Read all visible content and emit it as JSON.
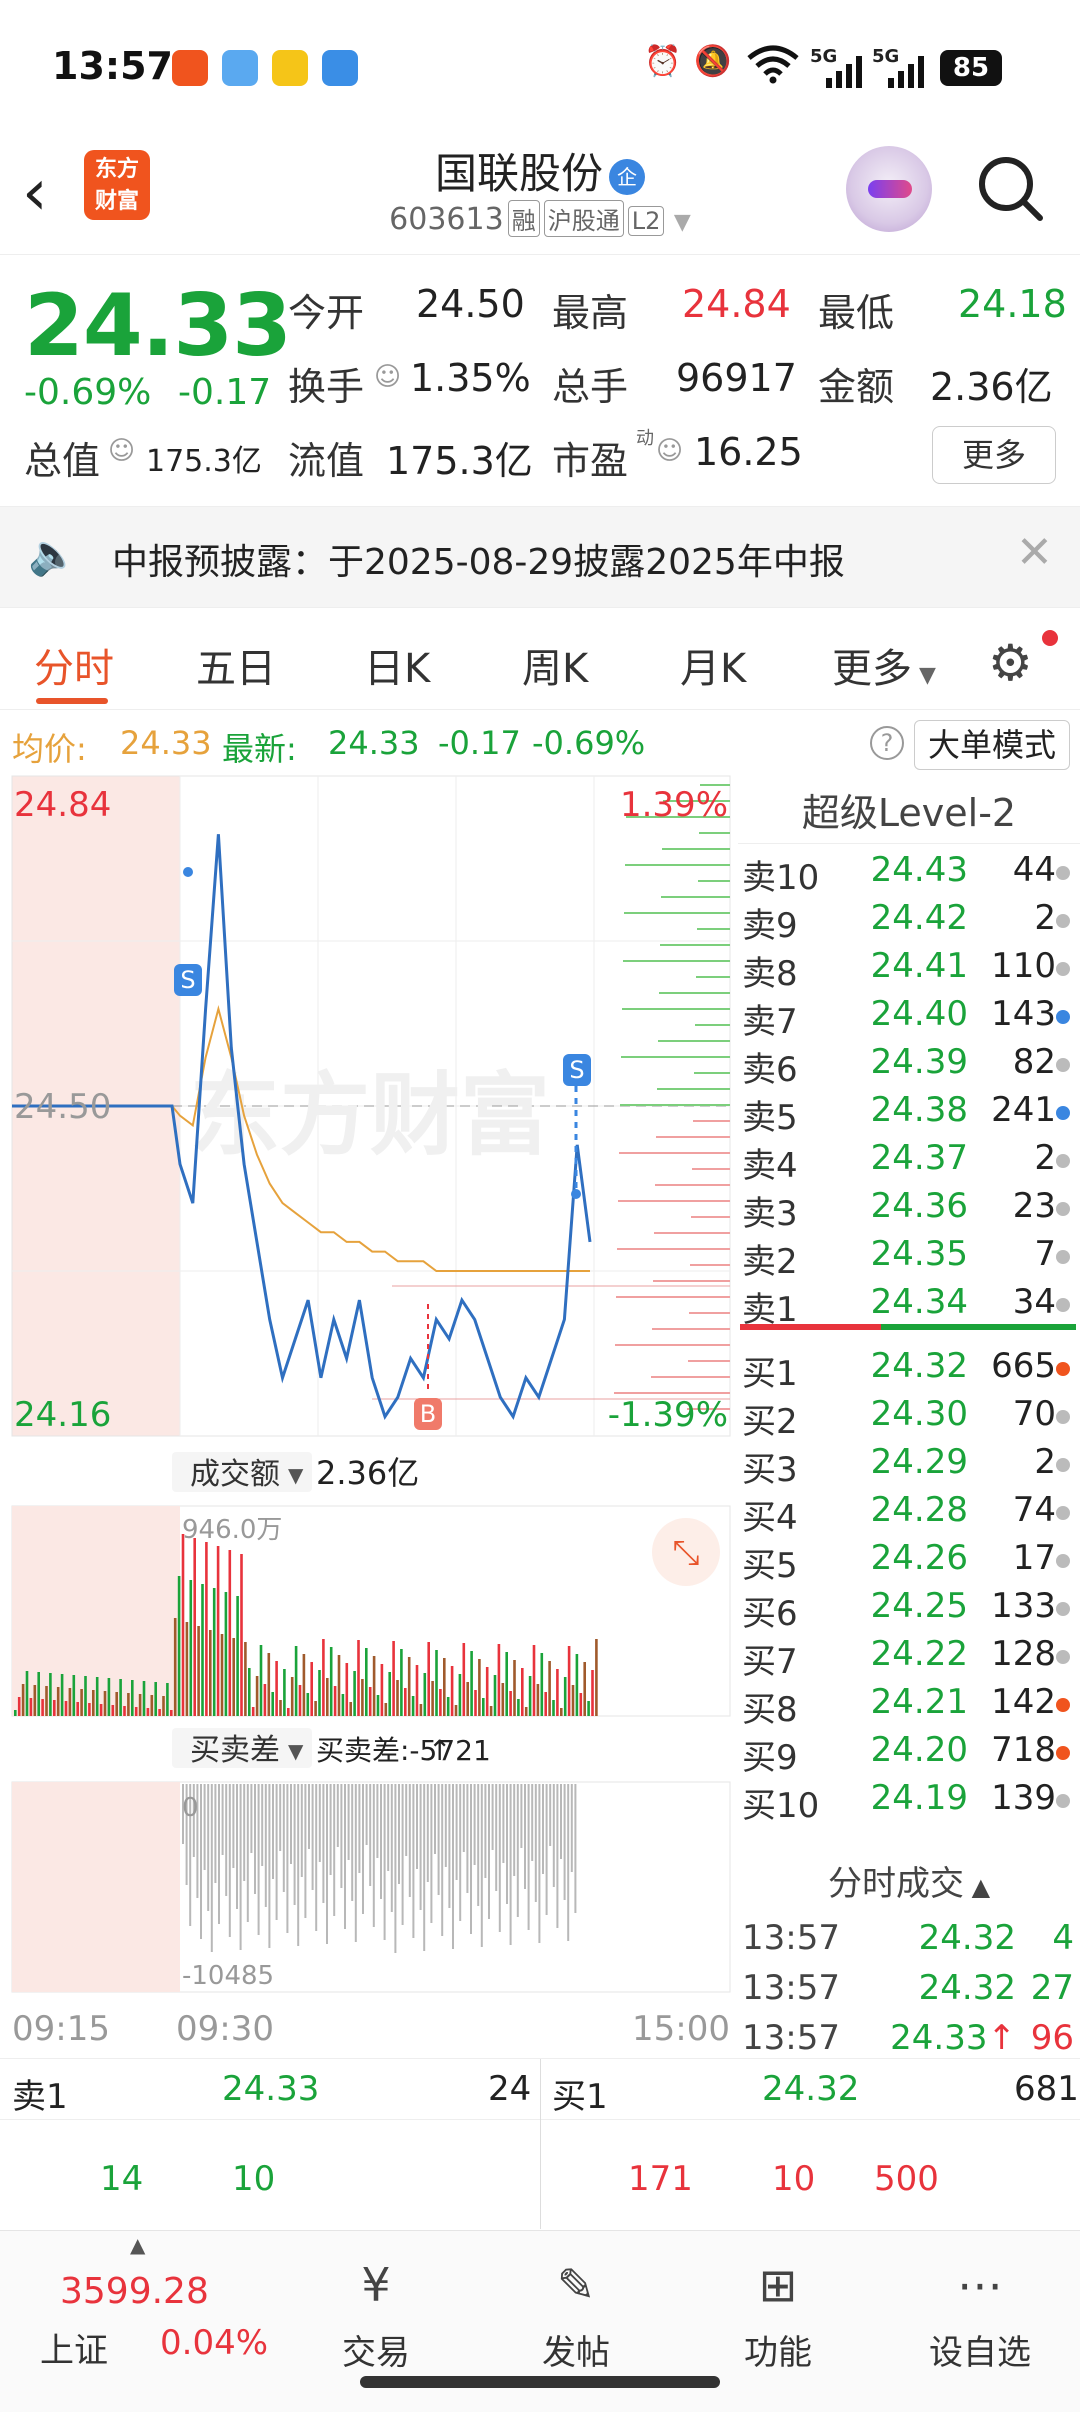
{
  "status_bar": {
    "time": "13:57",
    "network_1": "5G",
    "network_2": "5G",
    "battery": "85"
  },
  "header": {
    "logo_line1": "东方",
    "logo_line2": "财富",
    "stock_name": "国联股份",
    "stock_name_badge": "企",
    "stock_code": "603613",
    "tags": [
      "融",
      "沪股通",
      "L2"
    ]
  },
  "quote": {
    "price": "24.33",
    "change_pct": "-0.69%",
    "change": "-0.17",
    "open_label": "今开",
    "open": "24.50",
    "high_label": "最高",
    "high": "24.84",
    "low_label": "最低",
    "low": "24.18",
    "turnover_label": "换手",
    "turnover": "1.35%",
    "volume_label": "总手",
    "volume": "96917",
    "amount_label": "金额",
    "amount": "2.36亿",
    "mktcap_label": "总值",
    "mktcap": "175.3亿",
    "float_label": "流值",
    "float": "175.3亿",
    "pe_label": "市盈",
    "pe_sup": "动",
    "pe": "16.25",
    "more_label": "更多"
  },
  "notice": {
    "text": "中报预披露：于2025-08-29披露2025年中报"
  },
  "tabs": [
    "分时",
    "五日",
    "日K",
    "周K",
    "月K",
    "更多"
  ],
  "info_bar": {
    "avg_label": "均价:",
    "avg_value": "24.33",
    "latest_label": "最新:",
    "latest_value": "24.33",
    "latest_change": "-0.17",
    "latest_pct": "-0.69%",
    "help": "?",
    "big_order_mode": "大单模式"
  },
  "chart": {
    "top_price": "24.84",
    "mid_price": "24.50",
    "bottom_price": "24.16",
    "top_pct": "1.39%",
    "bottom_pct": "-1.39%",
    "marker_s": "S",
    "marker_b": "B",
    "watermark": "东方财富",
    "volume_selector": "成交额",
    "volume_total": "2.36亿",
    "volume_max": "946.0万",
    "diff_selector": "买卖差",
    "diff_label": "买卖差:-5721",
    "diff_zero": "0",
    "diff_min": "-10485",
    "time_start": "09:15",
    "time_open": "09:30",
    "time_end": "15:00",
    "colors": {
      "price_line": "#2f6fc0",
      "avg_line": "#e6a23c",
      "up": "#e8333c",
      "down": "#1aa33a"
    }
  },
  "chart_data": {
    "type": "line",
    "title": "",
    "xlabel": "",
    "ylabel": "",
    "ylim": [
      24.16,
      24.84
    ],
    "x_ticks": [
      "09:15",
      "09:30",
      "15:00"
    ],
    "series": [
      {
        "values": [
          24.5,
          24.5,
          24.5,
          24.44,
          24.4,
          24.6,
          24.78,
          24.56,
          24.44,
          24.36,
          24.28,
          24.22,
          24.26,
          24.3,
          24.22,
          24.28,
          24.24,
          24.3,
          24.22,
          24.18,
          24.2,
          24.24,
          24.22,
          24.28,
          24.26,
          24.3,
          24.28,
          24.24,
          24.2,
          24.18,
          24.22,
          24.2,
          24.24,
          24.28,
          24.46,
          24.36
        ]
      },
      {
        "values": [
          24.5,
          24.5,
          24.5,
          24.49,
          24.48,
          24.55,
          24.6,
          24.55,
          24.49,
          24.45,
          24.42,
          24.4,
          24.39,
          24.38,
          24.37,
          24.37,
          24.36,
          24.36,
          24.35,
          24.35,
          24.34,
          24.34,
          24.34,
          24.33,
          24.33,
          24.33,
          24.33,
          24.33,
          24.33,
          24.33,
          24.33,
          24.33,
          24.33,
          24.33,
          24.33,
          24.33
        ]
      }
    ]
  },
  "orderbook": {
    "title": "超级Level-2",
    "sells": [
      {
        "label": "卖10",
        "price": "24.43",
        "vol": "44",
        "dot": "gray"
      },
      {
        "label": "卖9",
        "price": "24.42",
        "vol": "2",
        "dot": "gray"
      },
      {
        "label": "卖8",
        "price": "24.41",
        "vol": "110",
        "dot": "gray"
      },
      {
        "label": "卖7",
        "price": "24.40",
        "vol": "143",
        "dot": "blue"
      },
      {
        "label": "卖6",
        "price": "24.39",
        "vol": "82",
        "dot": "gray"
      },
      {
        "label": "卖5",
        "price": "24.38",
        "vol": "241",
        "dot": "blue"
      },
      {
        "label": "卖4",
        "price": "24.37",
        "vol": "2",
        "dot": "gray"
      },
      {
        "label": "卖3",
        "price": "24.36",
        "vol": "23",
        "dot": "gray"
      },
      {
        "label": "卖2",
        "price": "24.35",
        "vol": "7",
        "dot": "gray"
      },
      {
        "label": "卖1",
        "price": "24.34",
        "vol": "34",
        "dot": "gray"
      }
    ],
    "buys": [
      {
        "label": "买1",
        "price": "24.32",
        "vol": "665",
        "dot": "orange"
      },
      {
        "label": "买2",
        "price": "24.30",
        "vol": "70",
        "dot": "gray"
      },
      {
        "label": "买3",
        "price": "24.29",
        "vol": "2",
        "dot": "gray"
      },
      {
        "label": "买4",
        "price": "24.28",
        "vol": "74",
        "dot": "gray"
      },
      {
        "label": "买5",
        "price": "24.26",
        "vol": "17",
        "dot": "gray"
      },
      {
        "label": "买6",
        "price": "24.25",
        "vol": "133",
        "dot": "gray"
      },
      {
        "label": "买7",
        "price": "24.22",
        "vol": "128",
        "dot": "gray"
      },
      {
        "label": "买8",
        "price": "24.21",
        "vol": "142",
        "dot": "orange"
      },
      {
        "label": "买9",
        "price": "24.20",
        "vol": "718",
        "dot": "orange"
      },
      {
        "label": "买10",
        "price": "24.19",
        "vol": "139",
        "dot": "gray"
      }
    ],
    "ticks_title": "分时成交",
    "ticks": [
      {
        "time": "13:57",
        "price": "24.32",
        "vol": "4"
      },
      {
        "time": "13:57",
        "price": "24.32",
        "vol": "27"
      },
      {
        "time": "13:57",
        "price": "24.33",
        "vol": "96"
      }
    ]
  },
  "summary": {
    "sell1_label": "卖1",
    "sell1_price": "24.33",
    "sell1_vol": "24",
    "sell_queue": [
      "14",
      "10"
    ],
    "buy1_label": "买1",
    "buy1_price": "24.32",
    "buy1_vol": "681",
    "buy_queue": [
      "171",
      "10",
      "500"
    ]
  },
  "bottom_nav": {
    "index_value": "3599.28",
    "index_name": "上证",
    "index_pct": "0.04%",
    "items": [
      "交易",
      "发帖",
      "功能",
      "设自选"
    ]
  }
}
